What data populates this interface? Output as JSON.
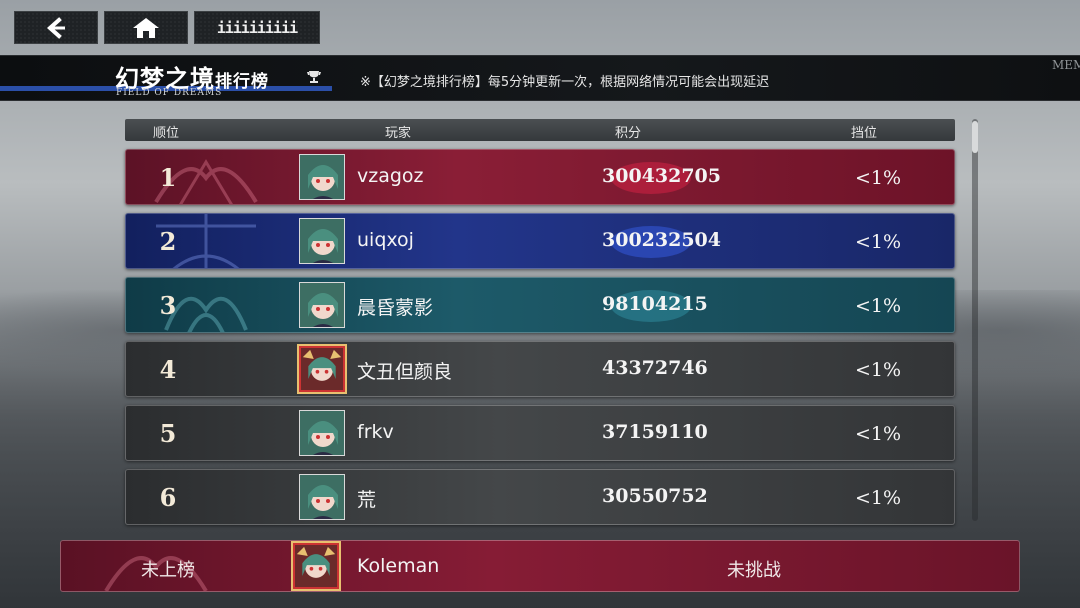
{
  "nav": {
    "menu_label": "iiiiiiiiii"
  },
  "title": {
    "main": "幻梦之境",
    "sub": "排行榜",
    "english": "FIELD OF DREAMS",
    "notice": "※【幻梦之境排行榜】每5分钟更新一次，根据网络情况可能会出现延迟",
    "side_deco": "MEMORY OF THE DEEP"
  },
  "columns": {
    "rank": "顺位",
    "player": "玩家",
    "score": "积分",
    "tier": "挡位"
  },
  "rows": [
    {
      "rank": "1",
      "name": "vzagoz",
      "score": "300432705",
      "tier": "<1%"
    },
    {
      "rank": "2",
      "name": "uiqxoj",
      "score": "300232504",
      "tier": "<1%"
    },
    {
      "rank": "3",
      "name": "晨昏蒙影",
      "score": "98104215",
      "tier": "<1%"
    },
    {
      "rank": "4",
      "name": "文丑但颜良",
      "score": "43372746",
      "tier": "<1%"
    },
    {
      "rank": "5",
      "name": "frkv",
      "score": "37159110",
      "tier": "<1%"
    },
    {
      "rank": "6",
      "name": "荒",
      "score": "30550752",
      "tier": "<1%"
    }
  ],
  "me": {
    "status": "未上榜",
    "name": "Koleman",
    "challenge": "未挑战"
  },
  "colors": {
    "gold_row": "#8a1e36",
    "silver_row": "#22358a",
    "bronze_row": "#1d5a69",
    "title_accent": "#2b4fa8"
  }
}
